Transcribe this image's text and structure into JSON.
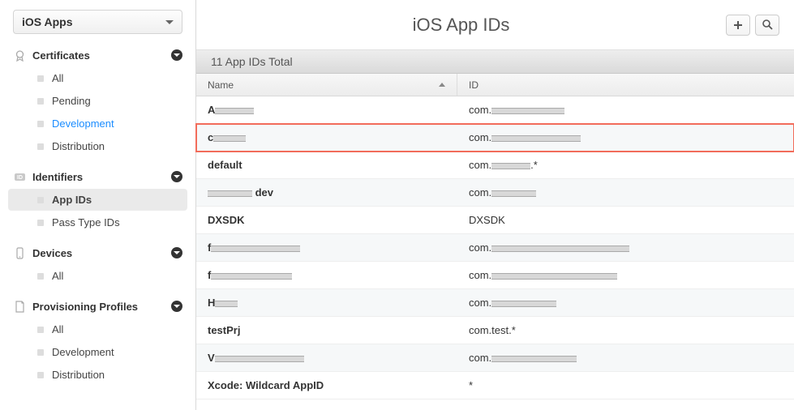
{
  "sidebar": {
    "dropdown_label": "iOS Apps",
    "sections": [
      {
        "icon": "certificate",
        "label": "Certificates",
        "items": [
          {
            "label": "All",
            "state": "normal"
          },
          {
            "label": "Pending",
            "state": "normal"
          },
          {
            "label": "Development",
            "state": "link"
          },
          {
            "label": "Distribution",
            "state": "normal"
          }
        ]
      },
      {
        "icon": "id",
        "label": "Identifiers",
        "items": [
          {
            "label": "App IDs",
            "state": "selected"
          },
          {
            "label": "Pass Type IDs",
            "state": "normal"
          }
        ]
      },
      {
        "icon": "device",
        "label": "Devices",
        "items": [
          {
            "label": "All",
            "state": "normal"
          }
        ]
      },
      {
        "icon": "profile",
        "label": "Provisioning Profiles",
        "items": [
          {
            "label": "All",
            "state": "normal"
          },
          {
            "label": "Development",
            "state": "normal"
          },
          {
            "label": "Distribution",
            "state": "normal"
          }
        ]
      }
    ]
  },
  "main": {
    "title": "iOS App IDs",
    "count_label": "11 App IDs Total",
    "columns": {
      "name": "Name",
      "id": "ID"
    },
    "rows": [
      {
        "name_prefix": "A",
        "name_redacted_w": 48,
        "id_prefix": "com.",
        "id_redacted_w": 90,
        "id_suffix": "",
        "highlight": false
      },
      {
        "name_prefix": "c",
        "name_redacted_w": 40,
        "id_prefix": "com.",
        "id_redacted_w": 110,
        "id_suffix": "",
        "highlight": true
      },
      {
        "name_prefix": "default",
        "name_redacted_w": 0,
        "id_prefix": "com.",
        "id_redacted_w": 48,
        "id_suffix": ".*",
        "highlight": false
      },
      {
        "name_prefix": "",
        "name_redacted_w": 55,
        "name_suffix": " dev",
        "id_prefix": "com.",
        "id_redacted_w": 55,
        "id_suffix": "",
        "highlight": false
      },
      {
        "name_prefix": "DXSDK",
        "name_redacted_w": 0,
        "id_prefix": "DXSDK",
        "id_redacted_w": 0,
        "id_suffix": "",
        "highlight": false
      },
      {
        "name_prefix": "f",
        "name_redacted_w": 110,
        "id_prefix": "com.",
        "id_redacted_w": 170,
        "id_suffix": "",
        "highlight": false
      },
      {
        "name_prefix": "f",
        "name_redacted_w": 100,
        "id_prefix": "com.",
        "id_redacted_w": 155,
        "id_suffix": "",
        "highlight": false
      },
      {
        "name_prefix": "H",
        "name_redacted_w": 28,
        "id_prefix": "com.",
        "id_redacted_w": 80,
        "id_suffix": "",
        "highlight": false
      },
      {
        "name_prefix": "testPrj",
        "name_redacted_w": 0,
        "id_prefix": "com.test.*",
        "id_redacted_w": 0,
        "id_suffix": "",
        "highlight": false
      },
      {
        "name_prefix": "V",
        "name_redacted_w": 110,
        "id_prefix": "com.",
        "id_redacted_w": 105,
        "id_suffix": "",
        "highlight": false
      },
      {
        "name_prefix": "Xcode: Wildcard AppID",
        "name_redacted_w": 0,
        "id_prefix": "*",
        "id_redacted_w": 0,
        "id_suffix": "",
        "highlight": false
      }
    ]
  }
}
